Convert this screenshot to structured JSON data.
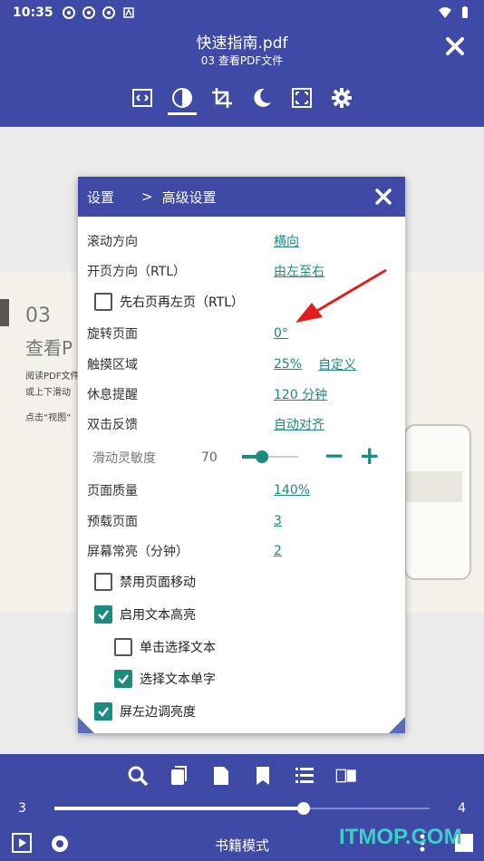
{
  "status_bar": {
    "time": "10:35"
  },
  "header": {
    "title": "快速指南.pdf",
    "subtitle": "03 查看PDF文件"
  },
  "toolbar": {
    "icons": [
      "fit-width-icon",
      "contrast-icon",
      "crop-icon",
      "night-mode-icon",
      "fullscreen-icon",
      "gear-icon"
    ]
  },
  "document": {
    "chapter_number": "03",
    "chapter_title": "查看P",
    "text_line1": "阅读PDF文件",
    "text_line2": "或上下滑动",
    "text_line3": "点击“视图”"
  },
  "dialog": {
    "crumb1": "设置",
    "separator": ">",
    "crumb2": "高级设置",
    "rows": {
      "scroll_direction": {
        "label": "滚动方向",
        "value": "横向"
      },
      "page_direction": {
        "label": "开页方向（RTL）",
        "value": "由左至右"
      },
      "rotate_page": {
        "label": "旋转页面",
        "value": "0°"
      },
      "touch_area": {
        "label": "触摸区域",
        "value": "25%",
        "extra": "自定义"
      },
      "rest_reminder": {
        "label": "休息提醒",
        "value": "120 分钟"
      },
      "double_tap": {
        "label": "双击反馈",
        "value": "自动对齐"
      },
      "sensitivity": {
        "label": "滑动灵敏度",
        "value": "70"
      },
      "page_quality": {
        "label": "页面质量",
        "value": "140%"
      },
      "preload_pages": {
        "label": "预载页面",
        "value": "3"
      },
      "screen_on": {
        "label": "屏幕常亮（分钟）",
        "value": "2"
      }
    },
    "checkboxes": {
      "right_first": {
        "label": "先右页再左页（RTL）",
        "checked": false
      },
      "disable_move": {
        "label": "禁用页面移动",
        "checked": false
      },
      "text_highlight": {
        "label": "启用文本高亮",
        "checked": true
      },
      "tap_select": {
        "label": "单击选择文本",
        "checked": false
      },
      "select_word": {
        "label": "选择文本单字",
        "checked": true
      },
      "left_brightness": {
        "label": "屏左边调亮度",
        "checked": true
      }
    },
    "sensitivity_level": 0.35,
    "minus_label": "−",
    "plus_label": "+"
  },
  "bottom": {
    "icons": [
      "search-icon",
      "pages-icon",
      "page-icon",
      "bookmark-icon",
      "list-icon",
      "two-page-icon"
    ],
    "page_from": "3",
    "page_to": "4",
    "page_progress": 0.67,
    "mode_label": "书籍模式"
  },
  "watermark": "ITMOP.COM",
  "colors": {
    "primary": "#3f4aa6",
    "accent": "#1f8a80",
    "annotation": "#e02020"
  }
}
